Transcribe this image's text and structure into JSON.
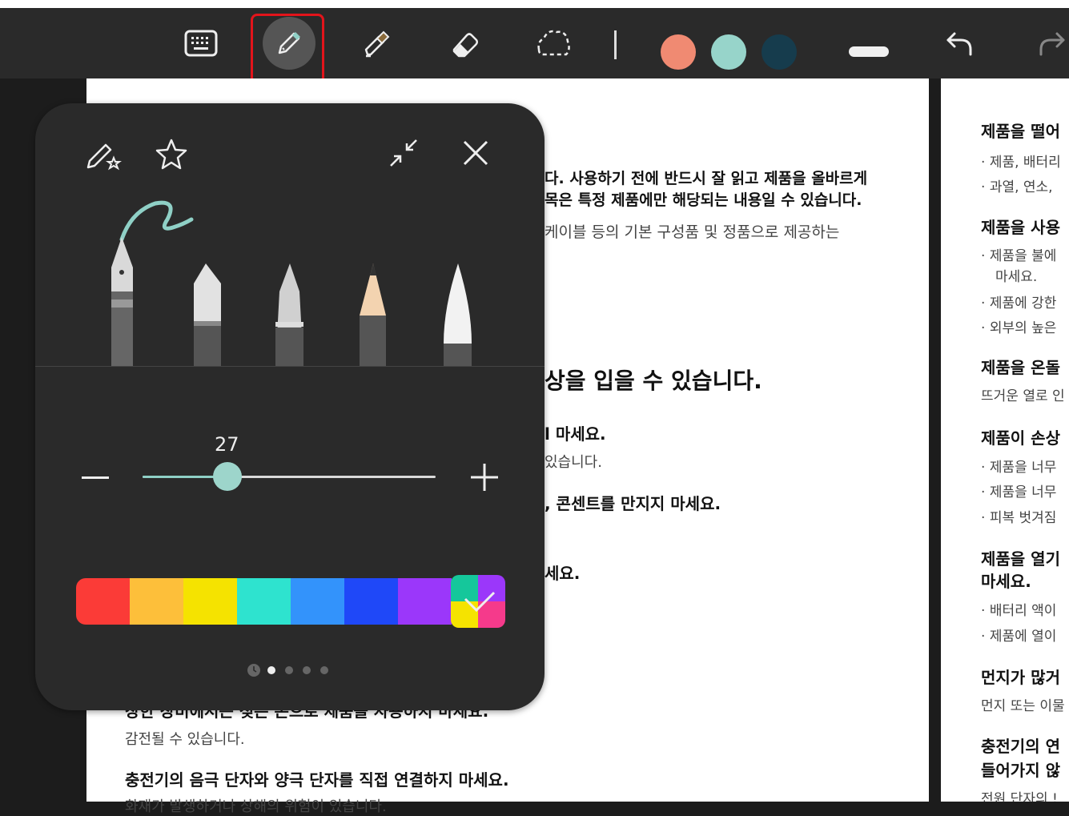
{
  "toolbar": {
    "tools": [
      "keyboard-icon",
      "pen-icon",
      "highlighter-icon",
      "eraser-icon",
      "lasso-icon"
    ],
    "colors": [
      "#f08a72",
      "#97d4ca",
      "#163c4d"
    ]
  },
  "pen_panel": {
    "size_value": "27",
    "size_fraction": 0.29,
    "pen_types": [
      "fountain-pen",
      "calligraphy-pen",
      "ballpoint-pen",
      "pencil",
      "brush-pen"
    ],
    "palette": [
      "#fb3b37",
      "#fdbf3a",
      "#f5e300",
      "#2ee3cf",
      "#3393fb",
      "#1f48f8",
      "#9b37fa",
      "#2e2e2e"
    ],
    "page_dots": 4,
    "active_dot": 0
  },
  "doc_left": {
    "intro_line1": "다. 사용하기 전에 반드시 잘 읽고 제품을 올바르게",
    "intro_line2": "목은 특정 제품에만 해당되는 내용일 수 있습니다.",
    "intro_line3": "케이블 등의 기본 구성품 및 정품으로 제공하는",
    "heading": "상을 입을 수 있습니다.",
    "item1_title": "l 마세요.",
    "item1_desc": "있습니다.",
    "item2_title": ", 콘센트를 만지지 마세요.",
    "item3_title": "세요.",
    "item4_title": "장한 장비에서는 젖은 손으로 제품을 사용하지 마세요.",
    "item4_desc": "감전될 수 있습니다.",
    "item5_title": "충전기의 음극 단자와 양극 단자를 직접 연결하지 마세요.",
    "item5_desc": "화재가 발생하거나 상해의 위험이 있습니다."
  },
  "doc_right": {
    "s1_title": "제품을 떨어",
    "s1_l1": "제품, 배터리",
    "s1_l2": "과열, 연소,",
    "s2_title": "제품을 사용",
    "s2_l1": "제품을 불에",
    "s2_l1b": "마세요.",
    "s2_l2": "제품에 강한",
    "s2_l3": "외부의 높은",
    "s3_title": "제품을 온돌",
    "s3_desc": "뜨거운 열로 인",
    "s4_title": "제품이 손상",
    "s4_l1": "제품을 너무",
    "s4_l2": "제품을 너무",
    "s4_l3": "피복 벗겨짐",
    "s5_title": "제품을 열기",
    "s5_title2": "마세요.",
    "s5_l1": "배터리 액이",
    "s5_l2": "제품에 열이",
    "s6_title": "먼지가 많거",
    "s6_desc": "먼지 또는 이물",
    "s7_title": "충전기의 연",
    "s7_title2": "들어가지 않",
    "s7_desc": "전원 단자의 !"
  }
}
